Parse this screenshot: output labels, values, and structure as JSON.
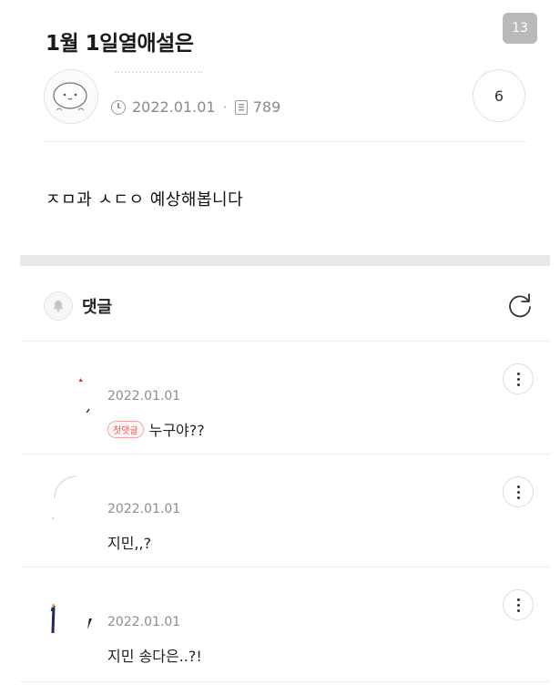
{
  "page_badge": "13",
  "post": {
    "title": "1월 1일열애설은",
    "date": "2022.01.01",
    "views": "789",
    "comment_count": "6",
    "body": "ㅈㅁ과 ㅅㄷㅇ 예상해봅니다"
  },
  "comments_section": {
    "title": "댓글"
  },
  "comments": [
    {
      "date": "2022.01.01",
      "tag": "첫댓글",
      "text": "누구야??"
    },
    {
      "date": "2022.01.01",
      "text": "지민,,?"
    },
    {
      "date": "2022.01.01",
      "text": "지민 송다은..?!"
    }
  ],
  "icons": {
    "clock": "clock-icon",
    "views": "document-icon",
    "bell": "bell-icon",
    "refresh": "refresh-icon",
    "more": "more-vertical-icon"
  },
  "colors": {
    "badge_bg": "#b9b9b9",
    "first_tag": "#e0575b",
    "section_bar": "#e9e9e9"
  }
}
